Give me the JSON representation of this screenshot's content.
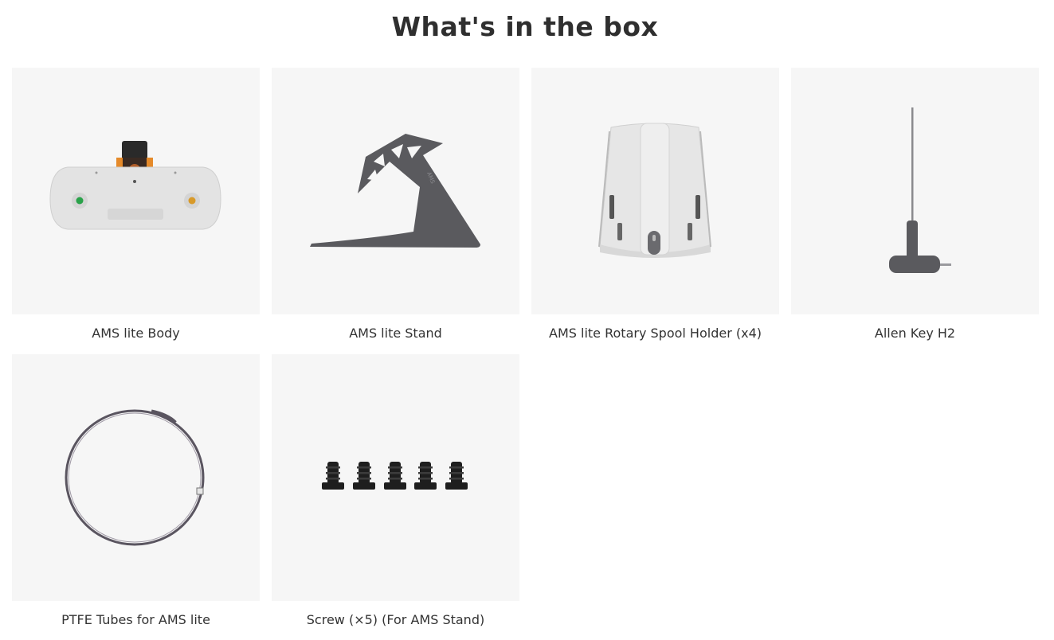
{
  "page": {
    "title": "What's in the box"
  },
  "items": [
    {
      "name": "AMS lite Body",
      "icon": "ams-lite-body-image"
    },
    {
      "name": "AMS lite Stand",
      "icon": "ams-lite-stand-image"
    },
    {
      "name": "AMS lite Rotary Spool Holder (x4)",
      "icon": "rotary-spool-holder-image"
    },
    {
      "name": "Allen Key H2",
      "icon": "allen-key-image"
    },
    {
      "name": "PTFE Tubes for AMS lite",
      "icon": "ptfe-tube-image"
    },
    {
      "name": "Screw (×5) (For AMS Stand)",
      "icon": "screw-image"
    }
  ],
  "colors": {
    "card_background": "#f6f6f6",
    "text": "#333333",
    "accent_orange": "#e58a2a",
    "accent_green": "#2aa24a",
    "stand_gray": "#5a5a5e"
  }
}
